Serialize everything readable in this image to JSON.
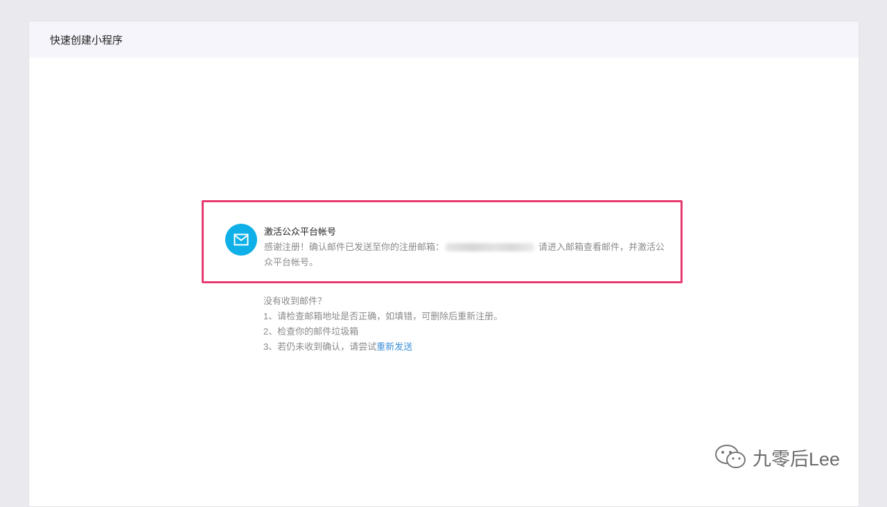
{
  "header": {
    "title": "快速创建小程序"
  },
  "notice": {
    "icon": "mail-icon",
    "accent_color": "#0fb0e8",
    "border_color": "#e6396f",
    "title": "激活公众平台帐号",
    "body_before": "感谢注册！确认邮件已发送至你的注册邮箱：",
    "body_after": "请进入邮箱查看邮件，并激活公众平台帐号。"
  },
  "help": {
    "heading": "没有收到邮件？",
    "item1": "1、请检查邮箱地址是否正确，如填错，可删除后重新注册。",
    "item2": "2、检查你的邮件垃圾箱",
    "item3_prefix": "3、若仍未收到确认，请尝试",
    "resend_link": "重新发送"
  },
  "watermark": {
    "text": "九零后Lee",
    "icon": "wechat-icon"
  }
}
